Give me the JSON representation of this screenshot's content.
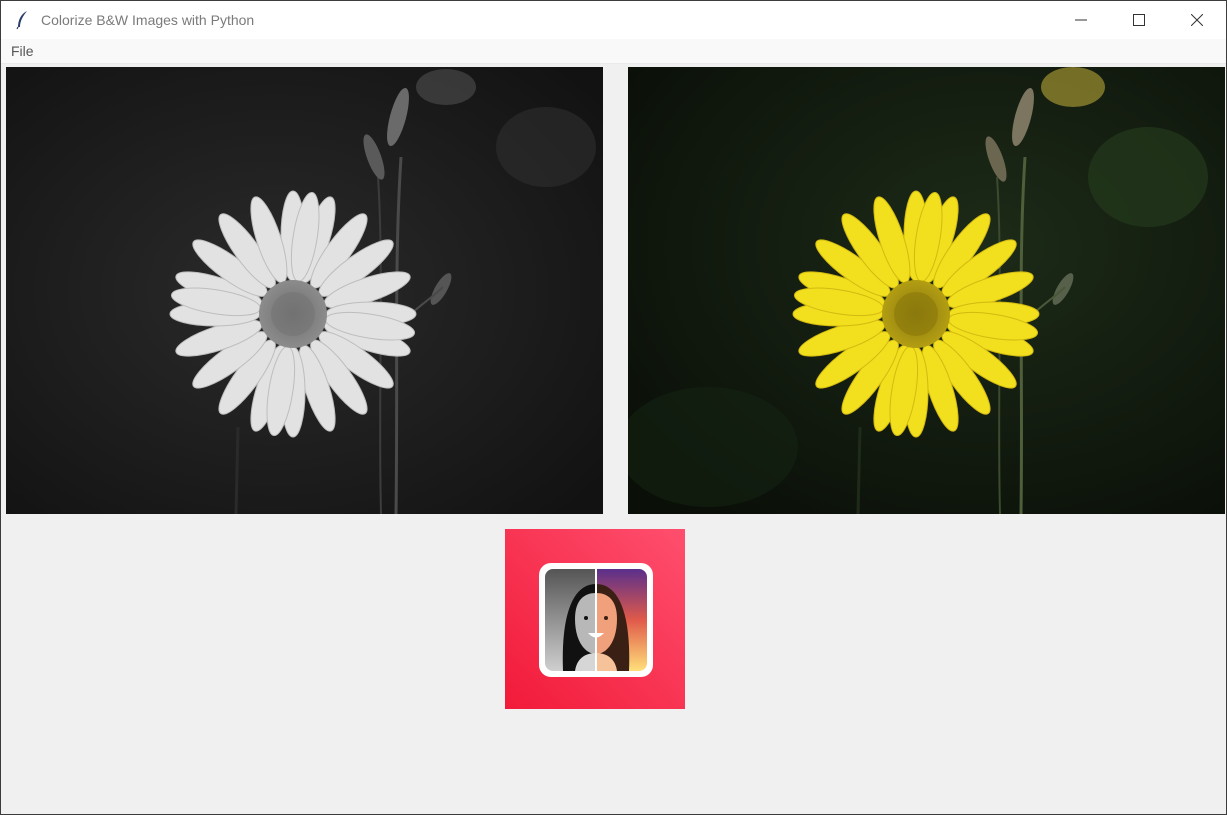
{
  "window": {
    "title": "Colorize B&W Images with Python",
    "icon": "feather-icon",
    "controls": [
      "minimize-icon",
      "maximize-icon",
      "close-icon"
    ]
  },
  "menu": {
    "items": [
      {
        "label": "File"
      }
    ]
  },
  "images": {
    "original": {
      "icon": "grayscale-daisy-photo"
    },
    "colorized": {
      "icon": "colorized-daisy-photo"
    }
  },
  "logo": {
    "icon": "colorize-app-logo"
  },
  "colors": {
    "title_bar": "#ffffff",
    "window_bg": "#f0f0f0",
    "flower_color": "#f2df1e",
    "logo_accent": "#ff3d5a"
  }
}
